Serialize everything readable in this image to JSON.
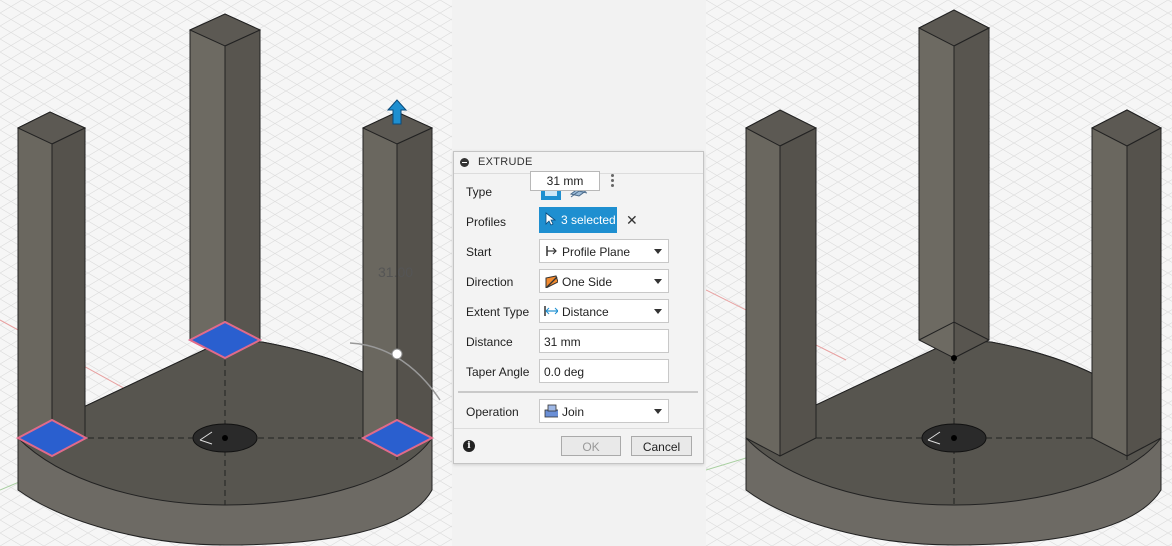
{
  "viewport_left": {
    "dimension_label": "31.00"
  },
  "dimension_input": {
    "value": "31 mm"
  },
  "extrude_panel": {
    "title": "EXTRUDE",
    "type_label": "Type",
    "profiles_label": "Profiles",
    "profiles_value": "3 selected",
    "start_label": "Start",
    "start_value": "Profile Plane",
    "direction_label": "Direction",
    "direction_value": "One Side",
    "extent_type_label": "Extent Type",
    "extent_type_value": "Distance",
    "distance_label": "Distance",
    "distance_value": "31 mm",
    "taper_angle_label": "Taper Angle",
    "taper_angle_value": "0.0 deg",
    "operation_label": "Operation",
    "operation_value": "Join",
    "ok_label": "OK",
    "cancel_label": "Cancel"
  },
  "colors": {
    "accent_blue": "#1e8fd0",
    "profile_fill": "#2a5fcf",
    "body_gray": "#6f6c66"
  }
}
